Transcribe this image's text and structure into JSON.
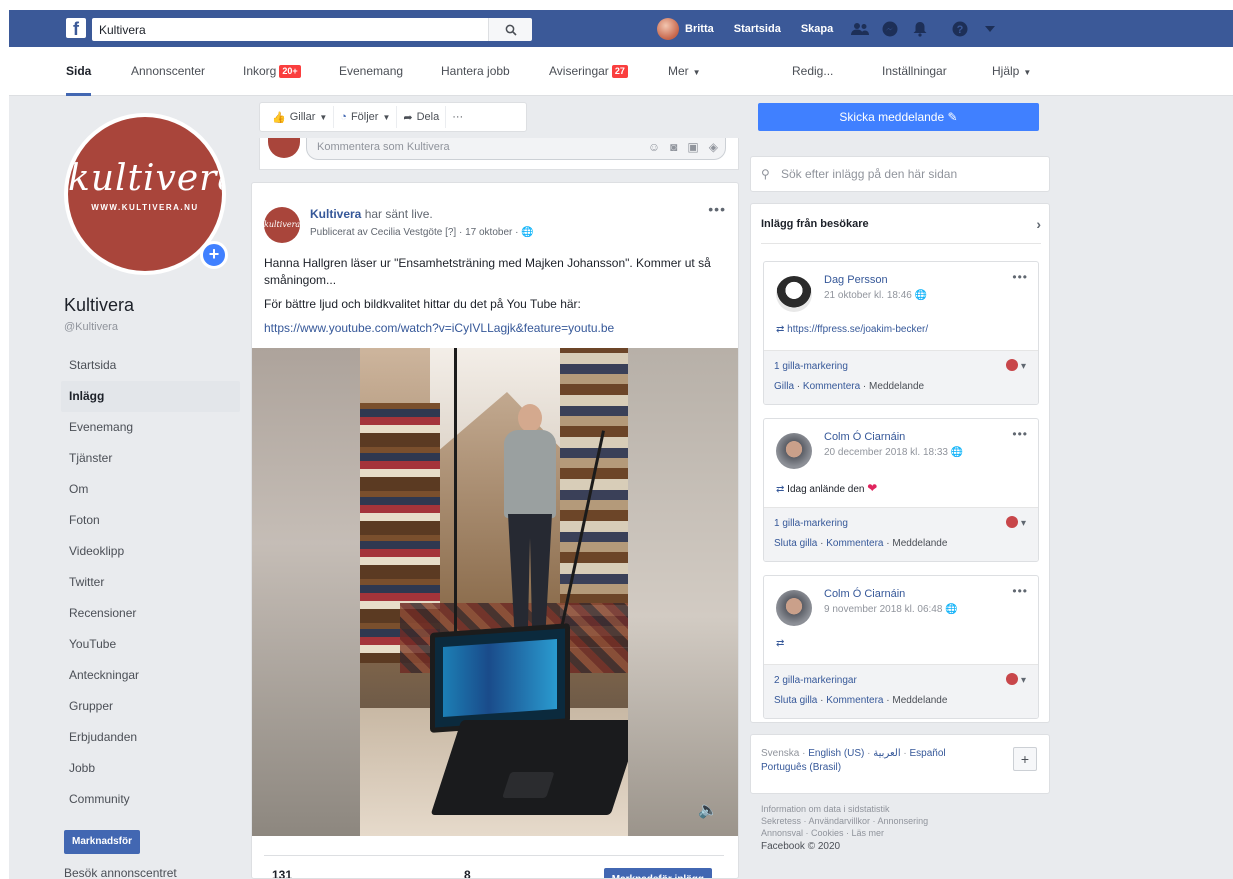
{
  "topbar": {
    "logo": "f",
    "search_value": "Kultivera",
    "user_name": "Britta",
    "home_label": "Startsida",
    "create_label": "Skapa"
  },
  "tabs": [
    {
      "label": "Sida",
      "active": true
    },
    {
      "label": "Annonscenter"
    },
    {
      "label": "Inkorg",
      "badge": "20+"
    },
    {
      "label": "Evenemang"
    },
    {
      "label": "Hantera jobb"
    },
    {
      "label": "Aviseringar",
      "badge": "27"
    },
    {
      "label": "Mer"
    },
    {
      "label": "Redig..."
    },
    {
      "label": "Inställningar"
    },
    {
      "label": "Hjälp"
    }
  ],
  "page": {
    "logo_word": "kultivera",
    "logo_url": "WWW.KULTIVERA.NU",
    "name": "Kultivera",
    "handle": "@Kultivera",
    "nav": [
      "Startsida",
      "Inlägg",
      "Evenemang",
      "Tjänster",
      "Om",
      "Foton",
      "Videoklipp",
      "Twitter",
      "Recensioner",
      "YouTube",
      "Anteckningar",
      "Grupper",
      "Erbjudanden",
      "Jobb",
      "Community"
    ],
    "active_nav": "Inlägg",
    "promote_label": "Marknadsför",
    "visit_ads_label": "Besök annonscentret"
  },
  "actions": {
    "like": "Gillar",
    "follow": "Följer",
    "share": "Dela",
    "more": "···"
  },
  "comment": {
    "placeholder": "Kommentera som Kultivera"
  },
  "post": {
    "avatar_text": "kultivera",
    "author": "Kultivera",
    "author_suffix": "har sänt live.",
    "meta": "Publicerat av Cecilia Vestgöte [?] · 17 oktober · ",
    "paragraph1": "Hanna Hallgren läser ur \"Ensamhetsträning med Majken Johansson\". Kommer ut så småningom...",
    "paragraph2": "För bättre ljud och bildkvalitet hittar du det på You Tube här:",
    "link": "https://www.youtube.com/watch?v=iCyIVLLagjk&feature=youtu.be",
    "stat_reached": "131",
    "stat_engagement": "8",
    "boost_label": "Marknadsför inlägg"
  },
  "right": {
    "send_message": "Skicka meddelande",
    "search_placeholder": "Sök efter inlägg på den här sidan",
    "visitors_title": "Inlägg från besökare",
    "visitors": [
      {
        "name": "Dag Persson",
        "time": "21 oktober kl. 18:46",
        "text": "https://ffpress.se/joakim-becker/",
        "likes": "1 gilla-markering",
        "action1": "Gilla",
        "action2": "Kommentera",
        "action3": "Meddelande"
      },
      {
        "name": "Colm Ó Ciarnáin",
        "time": "20 december 2018 kl. 18:33",
        "text": "Idag anlände den",
        "likes": "1 gilla-markering",
        "action1": "Sluta gilla",
        "action2": "Kommentera",
        "action3": "Meddelande"
      },
      {
        "name": "Colm Ó Ciarnáin",
        "time": "9 november 2018 kl. 06:48",
        "text": "",
        "likes": "2 gilla-markeringar",
        "action1": "Sluta gilla",
        "action2": "Kommentera",
        "action3": "Meddelande"
      }
    ],
    "languages_current": "Svenska",
    "languages": [
      "English (US)",
      "العربية",
      "Español",
      "Português (Brasil)"
    ],
    "footer_line1": "Information om data i sidstatistik",
    "footer_line2": "Sekretess · Användarvillkor · Annonsering",
    "footer_line3": "Annonsval · Cookies · Läs mer",
    "copyright": "Facebook © 2020"
  },
  "colors": {
    "brand_blue": "#3b5998",
    "accent_blue": "#4080ff",
    "page_red": "#a9453b"
  }
}
